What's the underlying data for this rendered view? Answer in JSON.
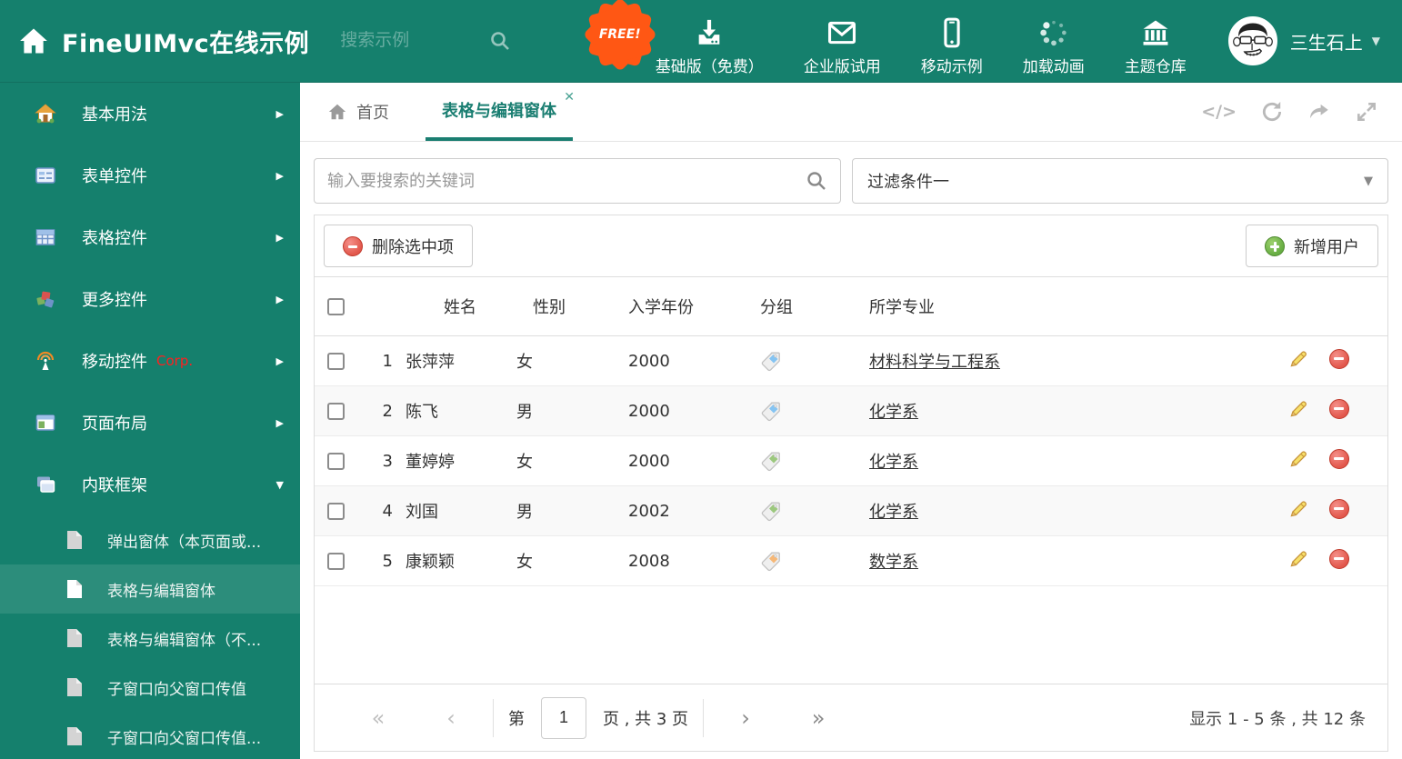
{
  "theme": {
    "teal": "#15806D",
    "accent": "#1A7E71",
    "danger_red": "#E2574C",
    "success_green": "#67AD43",
    "badge_orange": "#FF5714",
    "tag_colors": {
      "blue": "#85C4F2",
      "green": "#9CC87E",
      "orange": "#F6B877"
    }
  },
  "header": {
    "title": "FineUIMvc在线示例",
    "search_placeholder": "搜索示例",
    "nav_items": [
      {
        "icon": "download-icon",
        "label": "基础版（免费）",
        "badge": "FREE!"
      },
      {
        "icon": "envelope-icon",
        "label": "企业版试用"
      },
      {
        "icon": "mobile-icon",
        "label": "移动示例"
      },
      {
        "icon": "spinner-icon",
        "label": "加载动画"
      },
      {
        "icon": "bank-icon",
        "label": "主题仓库"
      }
    ],
    "user": {
      "name": "三生石上",
      "caret": "▼"
    }
  },
  "sidebar": {
    "items": [
      {
        "label": "基本用法",
        "icon": "home",
        "arrow": "▶"
      },
      {
        "label": "表单控件",
        "icon": "form",
        "arrow": "▶"
      },
      {
        "label": "表格控件",
        "icon": "grid",
        "arrow": "▶"
      },
      {
        "label": "更多控件",
        "icon": "cubes",
        "arrow": "▶"
      },
      {
        "label": "移动控件",
        "icon": "signal",
        "arrow": "▶",
        "badge": "Corp."
      },
      {
        "label": "页面布局",
        "icon": "layout",
        "arrow": "▶"
      },
      {
        "label": "内联框架",
        "icon": "frames",
        "arrow": "▼",
        "expanded": true,
        "children": [
          {
            "label": "弹出窗体（本页面或..."
          },
          {
            "label": "表格与编辑窗体",
            "selected": true
          },
          {
            "label": "表格与编辑窗体（不..."
          },
          {
            "label": "子窗口向父窗口传值"
          },
          {
            "label": "子窗口向父窗口传值..."
          }
        ]
      }
    ]
  },
  "tabs": [
    {
      "label": "首页",
      "icon": "home-tab-icon"
    },
    {
      "label": "表格与编辑窗体",
      "active": true,
      "close": "✕"
    }
  ],
  "search": {
    "placeholder": "输入要搜索的关键词"
  },
  "filter": {
    "value": "过滤条件一",
    "caret": "▼"
  },
  "toolbar": {
    "delete_label": "删除选中项",
    "add_label": "新增用户"
  },
  "table": {
    "columns": [
      "姓名",
      "性别",
      "入学年份",
      "分组",
      "所学专业"
    ],
    "rows": [
      {
        "num": "1",
        "name": "张萍萍",
        "gender": "女",
        "year": "2000",
        "tag": "blue",
        "major": "材料科学与工程系"
      },
      {
        "num": "2",
        "name": "陈飞",
        "gender": "男",
        "year": "2000",
        "tag": "blue",
        "major": "化学系"
      },
      {
        "num": "3",
        "name": "董婷婷",
        "gender": "女",
        "year": "2000",
        "tag": "green",
        "major": "化学系"
      },
      {
        "num": "4",
        "name": "刘国",
        "gender": "男",
        "year": "2002",
        "tag": "green",
        "major": "化学系"
      },
      {
        "num": "5",
        "name": "康颖颖",
        "gender": "女",
        "year": "2008",
        "tag": "orange",
        "major": "数学系"
      }
    ]
  },
  "pagination": {
    "icons": {
      "first": "«",
      "prev": "‹",
      "next": "›",
      "last": "»"
    },
    "page_prefix": "第",
    "page_value": "1",
    "page_suffix": "页 , 共 3 页",
    "summary": "显示 1 - 5 条 , 共 12 条"
  }
}
